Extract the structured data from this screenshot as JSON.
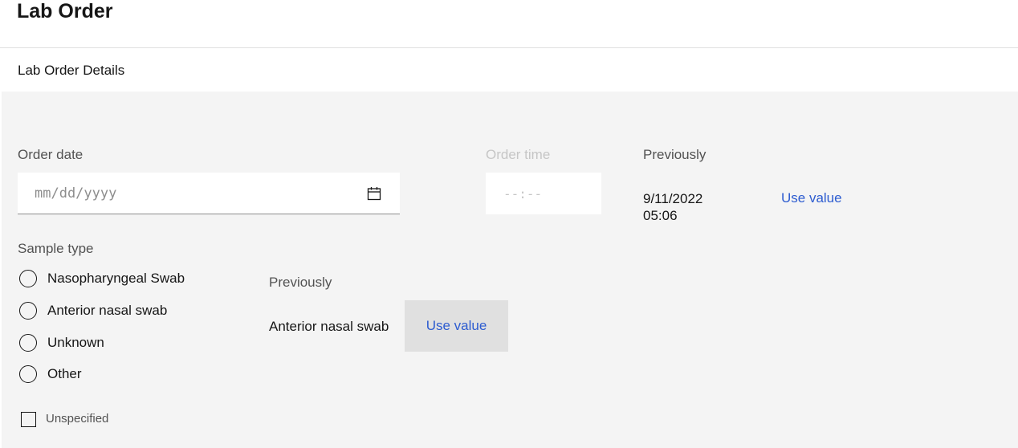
{
  "page": {
    "title": "Lab Order"
  },
  "section": {
    "title": "Lab Order Details"
  },
  "order_date": {
    "label": "Order date",
    "placeholder": "mm/dd/yyyy",
    "value": ""
  },
  "order_time": {
    "label": "Order time",
    "placeholder": "--:--",
    "value": ""
  },
  "previous_date": {
    "label": "Previously",
    "value_line1": "9/11/2022",
    "value_line2": "05:06",
    "use_value": "Use value"
  },
  "sample_type": {
    "label": "Sample type",
    "options": [
      {
        "label": "Nasopharyngeal Swab",
        "selected": false
      },
      {
        "label": "Anterior nasal swab",
        "selected": false
      },
      {
        "label": "Unknown",
        "selected": false
      },
      {
        "label": "Other",
        "selected": false
      }
    ]
  },
  "previous_sample": {
    "label": "Previously",
    "value": "Anterior nasal swab",
    "use_value": "Use value"
  },
  "unspecified": {
    "label": "Unspecified",
    "checked": false
  },
  "icons": {
    "calendar": "calendar-icon"
  },
  "colors": {
    "link": "#2d5cd0",
    "panel_bg": "#f4f4f4",
    "button_bg": "#e0e0e0"
  }
}
